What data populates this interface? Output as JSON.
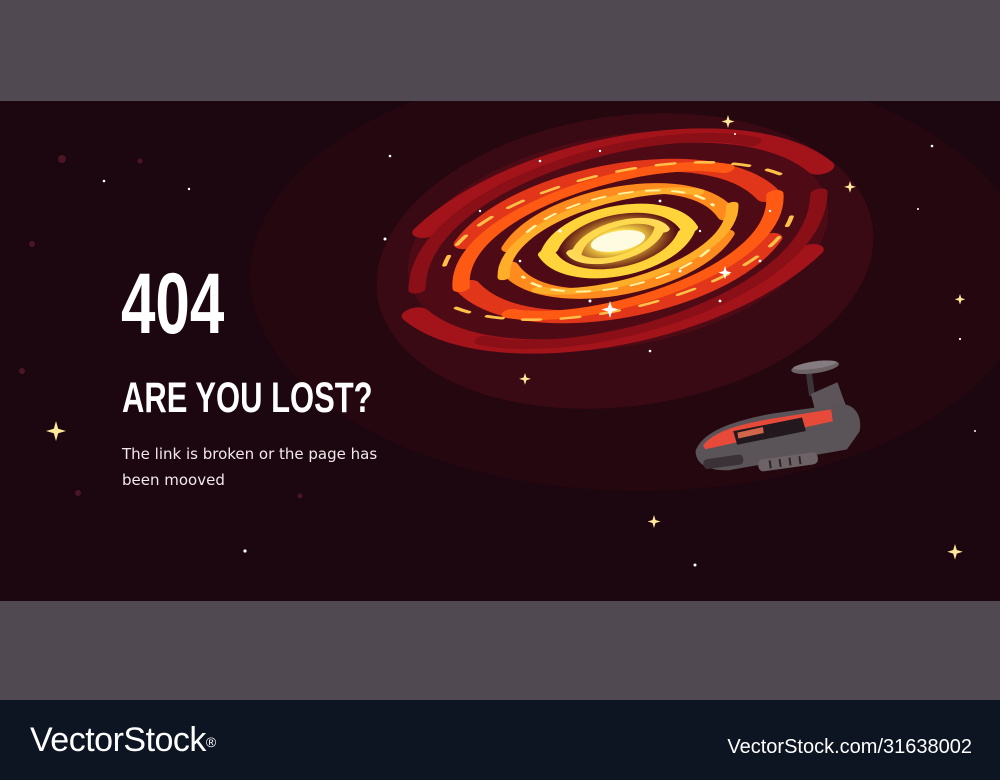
{
  "error": {
    "code": "404",
    "headline": "ARE YOU LOST?",
    "message": "The link is broken or the page has been mooved"
  },
  "watermark": {
    "brand": "VectorStock",
    "registered_mark": "®",
    "stock_id": "VectorStock.com/31638002"
  },
  "icons": {
    "galaxy": "spiral-galaxy-icon",
    "spaceship": "spaceship-icon",
    "star": "sparkle-star-icon"
  },
  "colors": {
    "space_background": "#1c060f",
    "galaxy_core": "#ffe14d",
    "galaxy_arm": "#ff6a14",
    "galaxy_outer": "#a3131a",
    "letterbox_band": "#514952",
    "footer_background": "#0d1523",
    "text": "#ffffff"
  }
}
